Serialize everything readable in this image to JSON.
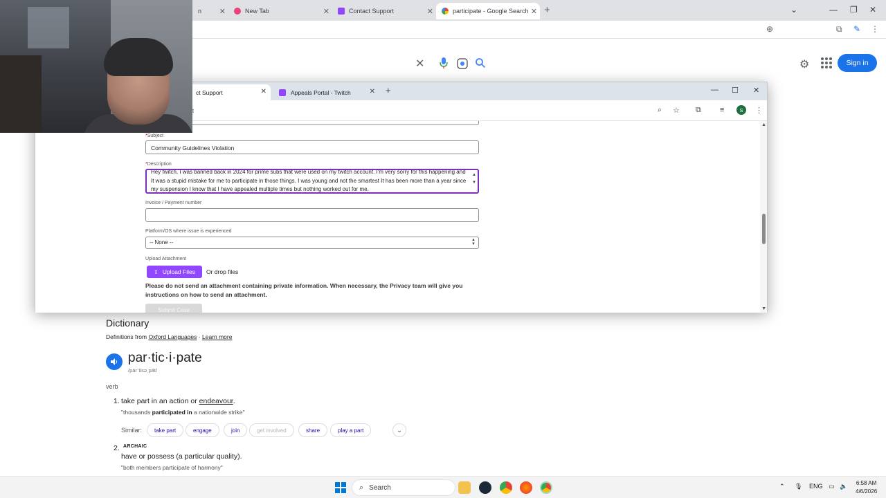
{
  "bg_browser": {
    "tabs": [
      {
        "label": "n"
      },
      {
        "label": "New Tab"
      },
      {
        "label": "Contact Support"
      },
      {
        "label": "participate - Google Search"
      }
    ]
  },
  "google": {
    "sign_in": "Sign in",
    "dictionary": {
      "title": "Dictionary",
      "source_prefix": "Definitions from",
      "source_link": "Oxford Languages",
      "source_sep": "·",
      "learn_more": "Learn more",
      "headword": "par·tic·i·pate",
      "phonetic": "/pärˈtisəˌpāt/",
      "pos": "verb",
      "definitions": [
        {
          "num": "1.",
          "text_before": "take part in an action or ",
          "link": "endeavour",
          "text_after": ".",
          "example_pre": "\"thousands ",
          "example_bold": "participated in",
          "example_post": " a nationwide strike\""
        },
        {
          "num": "2.",
          "tag": "ARCHAIC",
          "text": "have or possess (a particular quality).",
          "example": "\"both members participate of harmony\""
        }
      ],
      "similar_label": "Similar:",
      "similar": [
        "take part",
        "engage",
        "join",
        "get involved",
        "share",
        "play a part"
      ]
    }
  },
  "fg_browser": {
    "tabs": [
      {
        "label": "ct Support"
      },
      {
        "label": "Appeals Portal - Twitch"
      }
    ],
    "url": "rt",
    "avatar_letter": "S"
  },
  "form": {
    "subject_label": "Subject",
    "subject_value": "Community Guidelines Violation",
    "description_label": "Description",
    "description_value": "Hey twitch, I was banned back in 2024 for prime subs that were used on my twitch account. I'm very sorry for this happening and It was a stupid mistake for me to participate in those things. I was young and not the smartest It has been more than a year since my suspension I know that I have appealed multiple times but nothing worked out for me.",
    "invoice_label": "Invoice / Payment number",
    "invoice_value": "",
    "platform_label": "Platform/OS where issue is experienced",
    "platform_value": "-- None --",
    "upload_label": "Upload Attachment",
    "upload_button": "Upload Files",
    "drop_text": "Or drop files",
    "privacy_note": "Please do not send an attachment containing private information. When necessary, the Privacy team will give you instructions on how to send an attachment.",
    "submit_button": "Submit Case",
    "required_mark": "*"
  },
  "taskbar": {
    "search_label": "Search",
    "lang": "ENG",
    "time": "6:58 AM",
    "date": "4/6/2026"
  },
  "colors": {
    "twitch_purple": "#9146ff",
    "focus_border": "#7e2ebf",
    "google_blue": "#1a73e8"
  }
}
